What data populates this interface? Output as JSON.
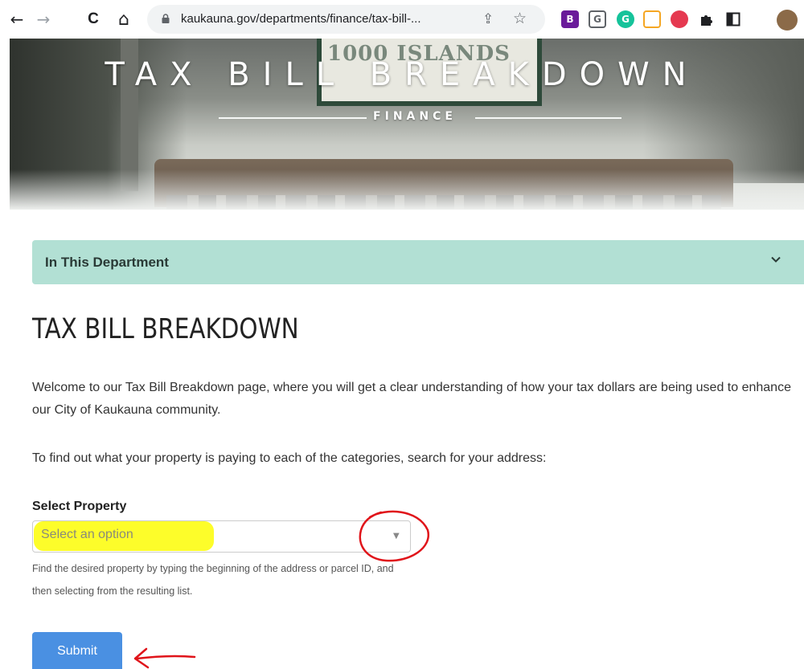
{
  "browser": {
    "url": "kaukauna.gov/departments/finance/tax-bill-...",
    "back_icon": "←",
    "forward_icon": "→",
    "reload_icon": "C",
    "home_icon": "⌂",
    "share_icon": "⇪",
    "star_icon": "☆",
    "extensions": [
      {
        "name": "extension-b-icon",
        "label": "B",
        "color": "#6a1b9a"
      },
      {
        "name": "extension-reader-icon",
        "label": "G",
        "color": "#5f6368"
      },
      {
        "name": "extension-grammarly-icon",
        "label": "G",
        "color": "#15c39a"
      },
      {
        "name": "extension-orange-icon",
        "label": "",
        "color": "#f5a623"
      },
      {
        "name": "extension-red-icon",
        "label": "",
        "color": "#e53950"
      }
    ]
  },
  "hero": {
    "title": "TAX BILL BREAKDOWN",
    "subtitle": "FINANCE",
    "sign_text": "1000 ISLANDS"
  },
  "department": {
    "label": "In This Department"
  },
  "main": {
    "title": "TAX BILL BREAKDOWN",
    "intro": "Welcome to our Tax Bill Breakdown page, where you will get a clear understanding of how your tax dollars are being used to enhance our City of Kaukauna community.",
    "instruction": "To find out what your property is paying to each of the categories, search for your address:",
    "field_label": "Select Property",
    "select_placeholder": "Select an option",
    "help_text": "Find the desired property by typing the beginning of the address or parcel ID, and then selecting from the resulting list.",
    "submit_label": "Submit"
  },
  "colors": {
    "dept_bar": "#b2e0d4",
    "submit": "#4a90e2",
    "highlight": "#fdfd2a",
    "annotation": "#e0141a"
  }
}
